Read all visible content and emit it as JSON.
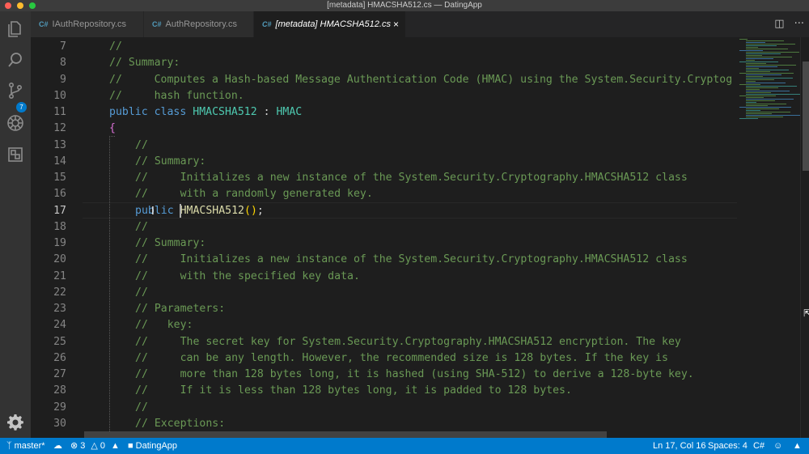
{
  "window": {
    "title": "[metadata] HMACSHA512.cs — DatingApp"
  },
  "activity_bar": {
    "items": [
      {
        "icon": "files-icon"
      },
      {
        "icon": "search-icon"
      },
      {
        "icon": "source-control-icon",
        "badge": "7"
      },
      {
        "icon": "debug-icon"
      },
      {
        "icon": "extensions-icon"
      }
    ],
    "bottom": {
      "icon": "gear-icon"
    }
  },
  "tabs": [
    {
      "icon_text": "C#",
      "label": "IAuthRepository.cs",
      "active": false
    },
    {
      "icon_text": "C#",
      "label": "AuthRepository.cs",
      "active": false
    },
    {
      "icon_text": "C#",
      "label": "[metadata] HMACSHA512.cs",
      "active": true,
      "close": "×"
    }
  ],
  "tab_actions": {
    "split": "split-editor-icon",
    "more": "···"
  },
  "editor": {
    "current_line": 17,
    "lines": [
      {
        "n": "7",
        "tokens": [
          [
            "c",
            "//"
          ]
        ],
        "indent": 0
      },
      {
        "n": "8",
        "tokens": [
          [
            "c",
            "// Summary:"
          ]
        ],
        "indent": 0
      },
      {
        "n": "9",
        "tokens": [
          [
            "c",
            "//     Computes a Hash-based Message Authentication Code (HMAC) using the System.Security.Cryptog"
          ]
        ],
        "indent": 0
      },
      {
        "n": "10",
        "tokens": [
          [
            "c",
            "//     hash function."
          ]
        ],
        "indent": 0
      },
      {
        "n": "11",
        "tokens": [
          [
            "k",
            "public"
          ],
          [
            "p",
            " "
          ],
          [
            "k",
            "class"
          ],
          [
            "p",
            " "
          ],
          [
            "t",
            "HMACSHA512"
          ],
          [
            "p",
            " : "
          ],
          [
            "t",
            "HMAC"
          ]
        ],
        "indent": 0
      },
      {
        "n": "12",
        "tokens": [
          [
            "b",
            "{"
          ]
        ],
        "indent": 0
      },
      {
        "n": "13",
        "tokens": [
          [
            "c",
            "//"
          ]
        ],
        "indent": 1
      },
      {
        "n": "14",
        "tokens": [
          [
            "c",
            "// Summary:"
          ]
        ],
        "indent": 1
      },
      {
        "n": "15",
        "tokens": [
          [
            "c",
            "//     Initializes a new instance of the System.Security.Cryptography.HMACSHA512 class"
          ]
        ],
        "indent": 1
      },
      {
        "n": "16",
        "tokens": [
          [
            "c",
            "//     with a randomly generated key."
          ]
        ],
        "indent": 1
      },
      {
        "n": "17",
        "tokens": [
          [
            "k",
            "public"
          ],
          [
            "p",
            " "
          ],
          [
            "f",
            "HMACSHA512"
          ],
          [
            "y",
            "()"
          ],
          [
            "p",
            ";"
          ]
        ],
        "indent": 1
      },
      {
        "n": "18",
        "tokens": [
          [
            "c",
            "//"
          ]
        ],
        "indent": 1
      },
      {
        "n": "19",
        "tokens": [
          [
            "c",
            "// Summary:"
          ]
        ],
        "indent": 1
      },
      {
        "n": "20",
        "tokens": [
          [
            "c",
            "//     Initializes a new instance of the System.Security.Cryptography.HMACSHA512 class"
          ]
        ],
        "indent": 1
      },
      {
        "n": "21",
        "tokens": [
          [
            "c",
            "//     with the specified key data."
          ]
        ],
        "indent": 1
      },
      {
        "n": "22",
        "tokens": [
          [
            "c",
            "//"
          ]
        ],
        "indent": 1
      },
      {
        "n": "23",
        "tokens": [
          [
            "c",
            "// Parameters:"
          ]
        ],
        "indent": 1
      },
      {
        "n": "24",
        "tokens": [
          [
            "c",
            "//   key:"
          ]
        ],
        "indent": 1
      },
      {
        "n": "25",
        "tokens": [
          [
            "c",
            "//     The secret key for System.Security.Cryptography.HMACSHA512 encryption. The key"
          ]
        ],
        "indent": 1
      },
      {
        "n": "26",
        "tokens": [
          [
            "c",
            "//     can be any length. However, the recommended size is 128 bytes. If the key is"
          ]
        ],
        "indent": 1
      },
      {
        "n": "27",
        "tokens": [
          [
            "c",
            "//     more than 128 bytes long, it is hashed (using SHA-512) to derive a 128-byte key."
          ]
        ],
        "indent": 1
      },
      {
        "n": "28",
        "tokens": [
          [
            "c",
            "//     If it is less than 128 bytes long, it is padded to 128 bytes."
          ]
        ],
        "indent": 1
      },
      {
        "n": "29",
        "tokens": [
          [
            "c",
            "//"
          ]
        ],
        "indent": 1
      },
      {
        "n": "30",
        "tokens": [
          [
            "c",
            "// Exceptions:"
          ]
        ],
        "indent": 1
      }
    ]
  },
  "status_bar": {
    "branch": "master*",
    "errors": "3",
    "warnings": "0",
    "project": "DatingApp",
    "position": "Ln 17, Col 16",
    "spaces": "Spaces: 4",
    "language": "C#"
  },
  "colors": {
    "accent": "#007acc",
    "comment": "#6a9955",
    "keyword": "#569cd6",
    "type": "#4ec9b0",
    "function": "#dcdcaa"
  }
}
